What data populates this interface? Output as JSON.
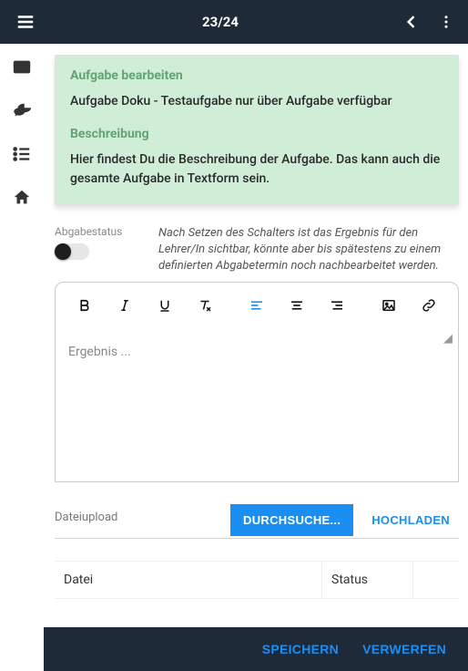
{
  "header": {
    "title": "23/24"
  },
  "task": {
    "editHeading": "Aufgabe bearbeiten",
    "editText": "Aufgabe Doku - Testaufgabe nur über Aufgabe verfügbar",
    "descHeading": "Beschreibung",
    "descText": "Hier findest Du die Beschreibung der Aufgabe. Das kann auch die gesamte Aufgabe in Textform sein."
  },
  "status": {
    "label": "Abgabestatus",
    "help": "Nach Setzen des Schalters ist das Ergebnis für den Lehrer/In sichtbar, könnte aber bis spätestens zu einem definierten Abgabetermin noch nachbearbeitet werden."
  },
  "editor": {
    "placeholder": "Ergebnis ..."
  },
  "upload": {
    "label": "Dateiupload",
    "browse": "DURCHSUCHE...",
    "upload": "HOCHLADEN"
  },
  "table": {
    "file": "Datei",
    "status": "Status"
  },
  "footer": {
    "save": "SPEICHERN",
    "discard": "VERWERFEN"
  }
}
